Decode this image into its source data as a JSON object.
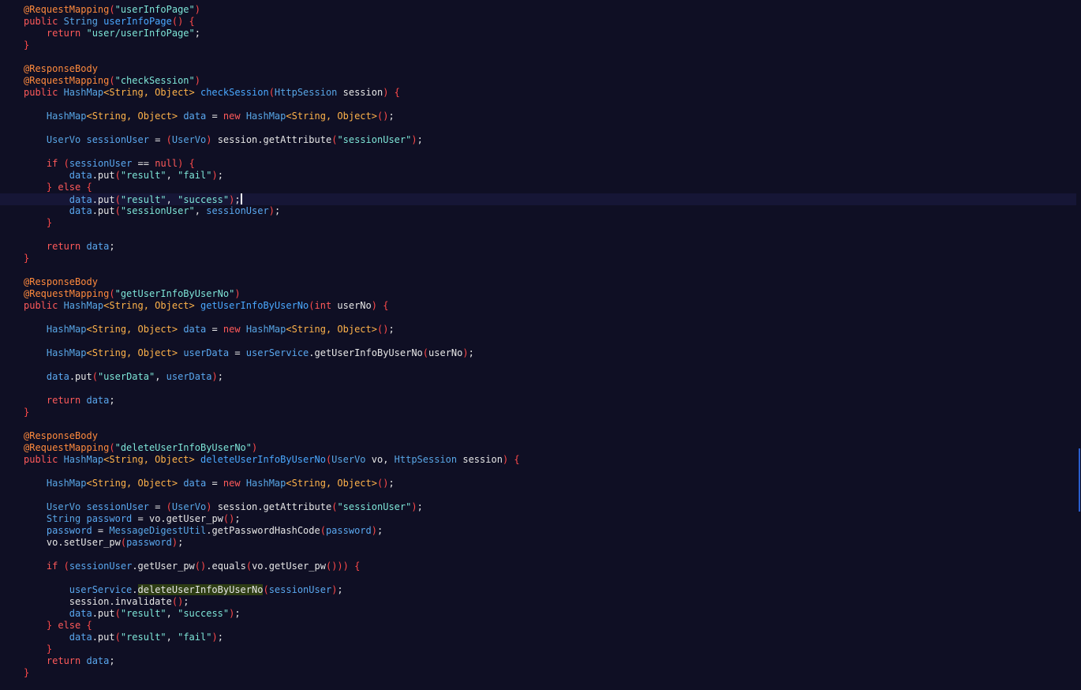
{
  "editor": {
    "language": "java",
    "lines": [
      [
        [
          "ann",
          "@RequestMapping"
        ],
        [
          "pu",
          "("
        ],
        [
          "str",
          "\"userInfoPage\""
        ],
        [
          "pu",
          ")"
        ]
      ],
      [
        [
          "kw",
          "public "
        ],
        [
          "type",
          "String "
        ],
        [
          "fn",
          "userInfoPage"
        ],
        [
          "pu",
          "() {"
        ]
      ],
      [
        [
          "pl",
          "    "
        ],
        [
          "kw",
          "return "
        ],
        [
          "str",
          "\"user/userInfoPage\""
        ],
        [
          "pl",
          ";"
        ]
      ],
      [
        [
          "pu",
          "}"
        ]
      ],
      [],
      [
        [
          "ann",
          "@ResponseBody"
        ]
      ],
      [
        [
          "ann",
          "@RequestMapping"
        ],
        [
          "pu",
          "("
        ],
        [
          "str",
          "\"checkSession\""
        ],
        [
          "pu",
          ")"
        ]
      ],
      [
        [
          "kw",
          "public "
        ],
        [
          "type",
          "HashMap"
        ],
        [
          "tyo",
          "<String, Object> "
        ],
        [
          "fn",
          "checkSession"
        ],
        [
          "pu",
          "("
        ],
        [
          "type",
          "HttpSession "
        ],
        [
          "pl",
          "session"
        ],
        [
          "pu",
          ") {"
        ]
      ],
      [],
      [
        [
          "pl",
          "    "
        ],
        [
          "type",
          "HashMap"
        ],
        [
          "tyo",
          "<String, Object> "
        ],
        [
          "var",
          "data"
        ],
        [
          "op",
          " = "
        ],
        [
          "kw",
          "new "
        ],
        [
          "type",
          "HashMap"
        ],
        [
          "tyo",
          "<String, Object>"
        ],
        [
          "pu",
          "()"
        ],
        [
          "pl",
          ";"
        ]
      ],
      [],
      [
        [
          "pl",
          "    "
        ],
        [
          "type",
          "UserVo "
        ],
        [
          "var",
          "sessionUser"
        ],
        [
          "op",
          " = "
        ],
        [
          "pu",
          "("
        ],
        [
          "type",
          "UserVo"
        ],
        [
          "pu",
          ") "
        ],
        [
          "pl",
          "session.getAttribute"
        ],
        [
          "pu",
          "("
        ],
        [
          "str",
          "\"sessionUser\""
        ],
        [
          "pu",
          ")"
        ],
        [
          "pl",
          ";"
        ]
      ],
      [],
      [
        [
          "pl",
          "    "
        ],
        [
          "kw",
          "if "
        ],
        [
          "pu",
          "("
        ],
        [
          "var",
          "sessionUser"
        ],
        [
          "op",
          " == "
        ],
        [
          "kw",
          "null"
        ],
        [
          "pu",
          ") {"
        ]
      ],
      [
        [
          "pl",
          "        "
        ],
        [
          "var",
          "data"
        ],
        [
          "pl",
          ".put"
        ],
        [
          "pu",
          "("
        ],
        [
          "str",
          "\"result\""
        ],
        [
          "pl",
          ", "
        ],
        [
          "str",
          "\"fail\""
        ],
        [
          "pu",
          ")"
        ],
        [
          "pl",
          ";"
        ]
      ],
      [
        [
          "pl",
          "    "
        ],
        [
          "pu",
          "} "
        ],
        [
          "kw",
          "else "
        ],
        [
          "pu",
          "{"
        ]
      ],
      [
        [
          "pl",
          "        "
        ],
        [
          "var",
          "data"
        ],
        [
          "pl",
          ".put"
        ],
        [
          "pu",
          "("
        ],
        [
          "str",
          "\"result\""
        ],
        [
          "pl",
          ", "
        ],
        [
          "str",
          "\"success\""
        ],
        [
          "pu",
          ")"
        ],
        [
          "pl",
          ";"
        ],
        [
          "caret",
          ""
        ]
      ],
      [
        [
          "pl",
          "        "
        ],
        [
          "var",
          "data"
        ],
        [
          "pl",
          ".put"
        ],
        [
          "pu",
          "("
        ],
        [
          "str",
          "\"sessionUser\""
        ],
        [
          "pl",
          ", "
        ],
        [
          "var",
          "sessionUser"
        ],
        [
          "pu",
          ")"
        ],
        [
          "pl",
          ";"
        ]
      ],
      [
        [
          "pl",
          "    "
        ],
        [
          "pu",
          "}"
        ]
      ],
      [],
      [
        [
          "pl",
          "    "
        ],
        [
          "kw",
          "return "
        ],
        [
          "var",
          "data"
        ],
        [
          "pl",
          ";"
        ]
      ],
      [
        [
          "pu",
          "}"
        ]
      ],
      [],
      [
        [
          "ann",
          "@ResponseBody"
        ]
      ],
      [
        [
          "ann",
          "@RequestMapping"
        ],
        [
          "pu",
          "("
        ],
        [
          "str",
          "\"getUserInfoByUserNo\""
        ],
        [
          "pu",
          ")"
        ]
      ],
      [
        [
          "kw",
          "public "
        ],
        [
          "type",
          "HashMap"
        ],
        [
          "tyo",
          "<String, Object> "
        ],
        [
          "fn",
          "getUserInfoByUserNo"
        ],
        [
          "pu",
          "("
        ],
        [
          "kw",
          "int "
        ],
        [
          "pl",
          "userNo"
        ],
        [
          "pu",
          ") {"
        ]
      ],
      [],
      [
        [
          "pl",
          "    "
        ],
        [
          "type",
          "HashMap"
        ],
        [
          "tyo",
          "<String, Object> "
        ],
        [
          "var",
          "data"
        ],
        [
          "op",
          " = "
        ],
        [
          "kw",
          "new "
        ],
        [
          "type",
          "HashMap"
        ],
        [
          "tyo",
          "<String, Object>"
        ],
        [
          "pu",
          "()"
        ],
        [
          "pl",
          ";"
        ]
      ],
      [],
      [
        [
          "pl",
          "    "
        ],
        [
          "type",
          "HashMap"
        ],
        [
          "tyo",
          "<String, Object> "
        ],
        [
          "var",
          "userData"
        ],
        [
          "op",
          " = "
        ],
        [
          "var",
          "userService"
        ],
        [
          "pl",
          ".getUserInfoByUserNo"
        ],
        [
          "pu",
          "("
        ],
        [
          "pl",
          "userNo"
        ],
        [
          "pu",
          ")"
        ],
        [
          "pl",
          ";"
        ]
      ],
      [],
      [
        [
          "pl",
          "    "
        ],
        [
          "var",
          "data"
        ],
        [
          "pl",
          ".put"
        ],
        [
          "pu",
          "("
        ],
        [
          "str",
          "\"userData\""
        ],
        [
          "pl",
          ", "
        ],
        [
          "var",
          "userData"
        ],
        [
          "pu",
          ")"
        ],
        [
          "pl",
          ";"
        ]
      ],
      [],
      [
        [
          "pl",
          "    "
        ],
        [
          "kw",
          "return "
        ],
        [
          "var",
          "data"
        ],
        [
          "pl",
          ";"
        ]
      ],
      [
        [
          "pu",
          "}"
        ]
      ],
      [],
      [
        [
          "ann",
          "@ResponseBody"
        ]
      ],
      [
        [
          "ann",
          "@RequestMapping"
        ],
        [
          "pu",
          "("
        ],
        [
          "str",
          "\"deleteUserInfoByUserNo\""
        ],
        [
          "pu",
          ")"
        ]
      ],
      [
        [
          "kw",
          "public "
        ],
        [
          "type",
          "HashMap"
        ],
        [
          "tyo",
          "<String, Object> "
        ],
        [
          "fn",
          "deleteUserInfoByUserNo"
        ],
        [
          "pu",
          "("
        ],
        [
          "type",
          "UserVo "
        ],
        [
          "pl",
          "vo, "
        ],
        [
          "type",
          "HttpSession "
        ],
        [
          "pl",
          "session"
        ],
        [
          "pu",
          ") {"
        ]
      ],
      [],
      [
        [
          "pl",
          "    "
        ],
        [
          "type",
          "HashMap"
        ],
        [
          "tyo",
          "<String, Object> "
        ],
        [
          "var",
          "data"
        ],
        [
          "op",
          " = "
        ],
        [
          "kw",
          "new "
        ],
        [
          "type",
          "HashMap"
        ],
        [
          "tyo",
          "<String, Object>"
        ],
        [
          "pu",
          "()"
        ],
        [
          "pl",
          ";"
        ]
      ],
      [],
      [
        [
          "pl",
          "    "
        ],
        [
          "type",
          "UserVo "
        ],
        [
          "var",
          "sessionUser"
        ],
        [
          "op",
          " = "
        ],
        [
          "pu",
          "("
        ],
        [
          "type",
          "UserVo"
        ],
        [
          "pu",
          ") "
        ],
        [
          "pl",
          "session.getAttribute"
        ],
        [
          "pu",
          "("
        ],
        [
          "str",
          "\"sessionUser\""
        ],
        [
          "pu",
          ")"
        ],
        [
          "pl",
          ";"
        ]
      ],
      [
        [
          "pl",
          "    "
        ],
        [
          "type",
          "String "
        ],
        [
          "var",
          "password"
        ],
        [
          "op",
          " = "
        ],
        [
          "pl",
          "vo.getUser_pw"
        ],
        [
          "pu",
          "()"
        ],
        [
          "pl",
          ";"
        ]
      ],
      [
        [
          "pl",
          "    "
        ],
        [
          "var",
          "password"
        ],
        [
          "op",
          " = "
        ],
        [
          "type",
          "MessageDigestUtil"
        ],
        [
          "pl",
          ".getPasswordHashCode"
        ],
        [
          "pu",
          "("
        ],
        [
          "var",
          "password"
        ],
        [
          "pu",
          ")"
        ],
        [
          "pl",
          ";"
        ]
      ],
      [
        [
          "pl",
          "    vo.setUser_pw"
        ],
        [
          "pu",
          "("
        ],
        [
          "var",
          "password"
        ],
        [
          "pu",
          ")"
        ],
        [
          "pl",
          ";"
        ]
      ],
      [],
      [
        [
          "pl",
          "    "
        ],
        [
          "kw",
          "if "
        ],
        [
          "pu",
          "("
        ],
        [
          "var",
          "sessionUser"
        ],
        [
          "pl",
          ".getUser_pw"
        ],
        [
          "pu",
          "()"
        ],
        [
          "pl",
          ".equals"
        ],
        [
          "pu",
          "("
        ],
        [
          "pl",
          "vo.getUser_pw"
        ],
        [
          "pu",
          "())) {"
        ]
      ],
      [],
      [
        [
          "pl",
          "        "
        ],
        [
          "var",
          "userService"
        ],
        [
          "pl",
          "."
        ],
        [
          "hl",
          "deleteUserInfoByUserNo"
        ],
        [
          "pu",
          "("
        ],
        [
          "var",
          "sessionUser"
        ],
        [
          "pu",
          ")"
        ],
        [
          "pl",
          ";"
        ]
      ],
      [
        [
          "pl",
          "        session.invalidate"
        ],
        [
          "pu",
          "()"
        ],
        [
          "pl",
          ";"
        ]
      ],
      [
        [
          "pl",
          "        "
        ],
        [
          "var",
          "data"
        ],
        [
          "pl",
          ".put"
        ],
        [
          "pu",
          "("
        ],
        [
          "str",
          "\"result\""
        ],
        [
          "pl",
          ", "
        ],
        [
          "str",
          "\"success\""
        ],
        [
          "pu",
          ")"
        ],
        [
          "pl",
          ";"
        ]
      ],
      [
        [
          "pl",
          "    "
        ],
        [
          "pu",
          "} "
        ],
        [
          "kw",
          "else "
        ],
        [
          "pu",
          "{"
        ]
      ],
      [
        [
          "pl",
          "        "
        ],
        [
          "var",
          "data"
        ],
        [
          "pl",
          ".put"
        ],
        [
          "pu",
          "("
        ],
        [
          "str",
          "\"result\""
        ],
        [
          "pl",
          ", "
        ],
        [
          "str",
          "\"fail\""
        ],
        [
          "pu",
          ")"
        ],
        [
          "pl",
          ";"
        ]
      ],
      [
        [
          "pl",
          "    "
        ],
        [
          "pu",
          "}"
        ]
      ],
      [
        [
          "pl",
          "    "
        ],
        [
          "kw",
          "return "
        ],
        [
          "var",
          "data"
        ],
        [
          "pl",
          ";"
        ]
      ],
      [
        [
          "pu",
          "}"
        ]
      ]
    ],
    "current_line": 16,
    "colors": {
      "background": "#0f0f24",
      "keyword": "#ff5a5a",
      "annotation": "#ff8a3d",
      "type": "#58a6e6",
      "generic": "#ffb34a",
      "method": "#4aa8ff",
      "string": "#7ee6d8",
      "variable": "#5aa8f0",
      "plain": "#e6e6e6",
      "selection_highlight": "#2e3d14",
      "scrollbar_thumb": "#2a5fd0"
    }
  }
}
